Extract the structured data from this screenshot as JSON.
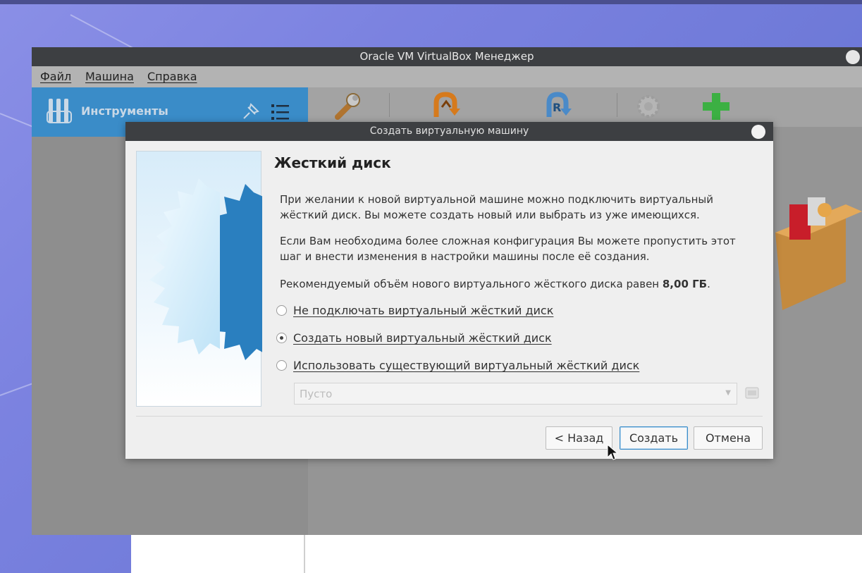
{
  "manager": {
    "title": "Oracle VM VirtualBox Менеджер",
    "menu": [
      "Файл",
      "Машина",
      "Справка"
    ],
    "sidebar": {
      "tools_label": "Инструменты"
    },
    "toolbar": {
      "icons": [
        "settings-wrench-icon",
        "discard-icon",
        "start-icon",
        "cogwheel-icon",
        "add-plus-icon"
      ]
    }
  },
  "dialog": {
    "title": "Создать виртуальную машину",
    "heading": "Жесткий диск",
    "paragraph1": "При желании к новой виртуальной машине можно подключить виртуальный жёсткий диск. Вы можете создать новый или выбрать из уже имеющихся.",
    "paragraph2": "Если Вам необходима более сложная конфигурация Вы можете пропустить этот шаг и внести изменения в настройки машины после её создания.",
    "recommend_prefix": "Рекомендуемый объём нового виртуального жёсткого диска равен ",
    "recommend_size": "8,00 ГБ",
    "recommend_suffix": ".",
    "options": [
      {
        "label": "Не подключать виртуальный жёсткий диск",
        "checked": false
      },
      {
        "label": "Создать новый виртуальный жёсткий диск",
        "checked": true
      },
      {
        "label": "Использовать существующий виртуальный жёсткий диск",
        "checked": false
      }
    ],
    "disk_select_value": "Пусто",
    "buttons": {
      "back": "< Назад",
      "create": "Создать",
      "cancel": "Отмена"
    }
  },
  "colors": {
    "accent": "#3a8cc8",
    "title_bar": "#3d3f42",
    "dialog_bg": "#efefef"
  }
}
